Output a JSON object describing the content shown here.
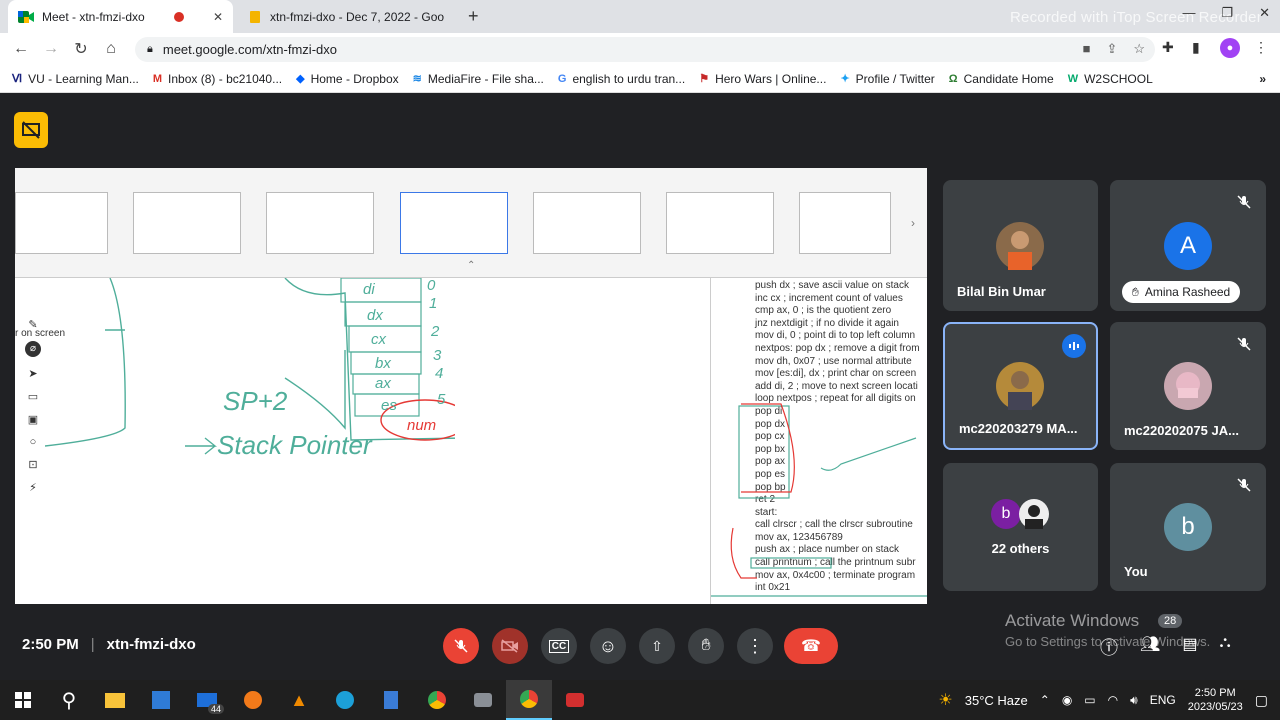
{
  "recorder_watermark": "Recorded with iTop Screen Recorder",
  "tabs": [
    {
      "title": "Meet - xtn-fmzi-dxo",
      "active": true
    },
    {
      "title": "xtn-fmzi-dxo - Dec 7, 2022 - Goo",
      "active": false
    }
  ],
  "address": {
    "url": "meet.google.com/xtn-fmzi-dxo"
  },
  "bookmarks": [
    {
      "label": "VU - Learning Man...",
      "icon": "vu-icon"
    },
    {
      "label": "Inbox (8) - bc21040...",
      "icon": "gmail-icon"
    },
    {
      "label": "Home - Dropbox",
      "icon": "dropbox-icon"
    },
    {
      "label": "MediaFire - File sha...",
      "icon": "mediafire-icon"
    },
    {
      "label": "english to urdu tran...",
      "icon": "google-icon"
    },
    {
      "label": "Hero Wars | Online...",
      "icon": "herowars-icon"
    },
    {
      "label": "Profile / Twitter",
      "icon": "twitter-icon"
    },
    {
      "label": "Candidate Home",
      "icon": "candidate-icon"
    },
    {
      "label": "W2SCHOOL",
      "icon": "w2school-icon"
    }
  ],
  "presentation": {
    "left_text": "r on screen",
    "handwriting_sp": "SP+2",
    "handwriting_stack": "Stack Pointer",
    "stack_labels": [
      "di",
      "dx",
      "cx",
      "bx",
      "ax",
      "es",
      "num"
    ],
    "stack_nums": [
      "0",
      "1",
      "2",
      "3",
      "4",
      "5"
    ],
    "code_lines": [
      "push dx ; save ascii value on stack",
      "inc cx ; increment count of values",
      "cmp ax, 0 ; is the quotient zero",
      "jnz nextdigit ; if no divide it again",
      "mov di, 0 ; point di to top left column",
      "nextpos: pop dx ; remove a digit from",
      "mov dh, 0x07 ; use normal attribute",
      "mov [es:di], dx ; print char on screen",
      "add di, 2 ; move to next screen locati",
      "loop nextpos ; repeat for all digits on",
      "pop di",
      "pop dx",
      "pop cx",
      "pop bx",
      "pop ax",
      "pop es",
      "pop bp",
      "ret 2",
      "start:",
      " call clrscr ; call the clrscr subroutine",
      "mov ax, 123456789",
      "push ax ; place number on stack",
      "call printnum ; call the printnum subr",
      "mov ax, 0x4c00 ; terminate program",
      "int 0x21"
    ]
  },
  "participants": [
    {
      "name": "Bilal Bin Umar",
      "muted": false,
      "avatar": "photo"
    },
    {
      "name": "Amina Rasheed",
      "muted": true,
      "avatar": "A",
      "color": "#1a73e8"
    },
    {
      "name": "mc220203279 MA...",
      "muted": false,
      "speaking": true,
      "avatar": "photo"
    },
    {
      "name": "mc220202075 JA...",
      "muted": true,
      "avatar": "photo"
    },
    {
      "name": "22 others",
      "muted": false,
      "avatar": "b"
    },
    {
      "name": "You",
      "muted": true,
      "avatar": "b",
      "color": "#5f8f9f"
    }
  ],
  "meeting": {
    "time": "2:50 PM",
    "code": "xtn-fmzi-dxo"
  },
  "windows": {
    "activate_title": "Activate Windows",
    "activate_sub": "Go to Settings to activate Windows.",
    "notif_count": "28",
    "mail_badge": "44",
    "weather": "35°C  Haze",
    "lang": "ENG",
    "clock_time": "2:50 PM",
    "clock_date": "2023/05/23"
  }
}
